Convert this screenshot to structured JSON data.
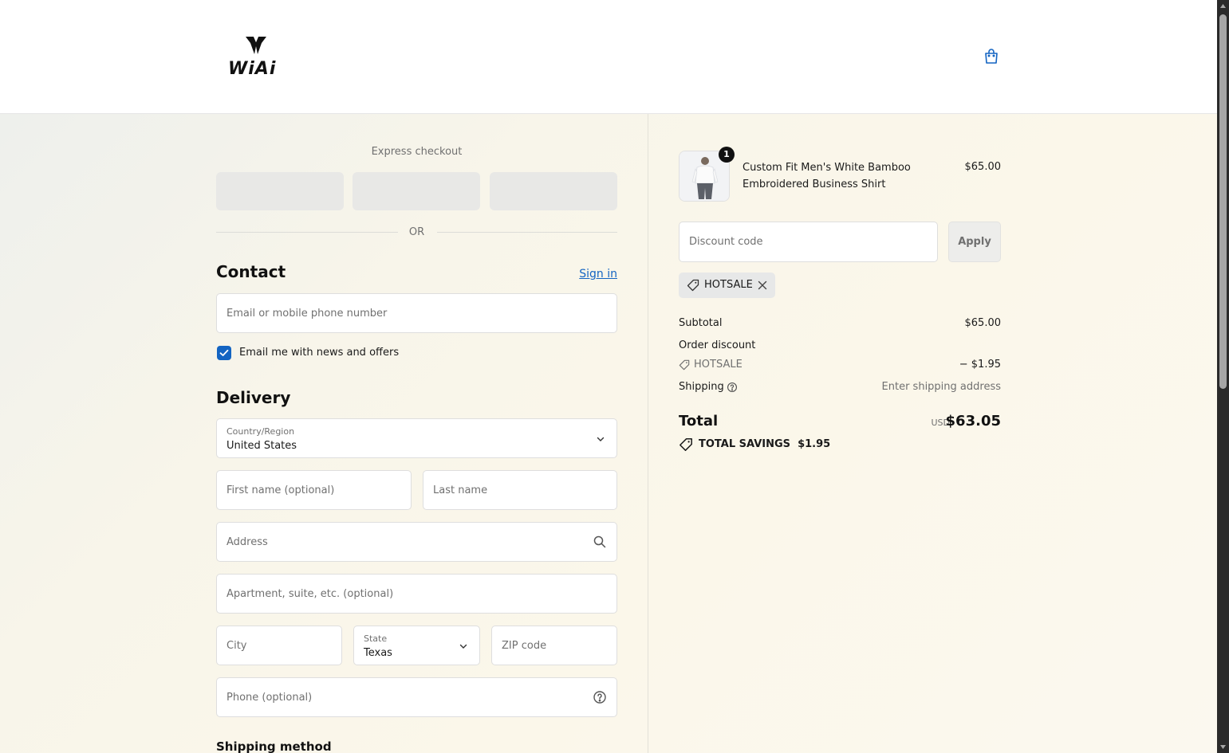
{
  "header": {
    "logo_text": "WiAi",
    "cart_icon": "shopping-bag-icon"
  },
  "express": {
    "title": "Express checkout",
    "or_label": "OR"
  },
  "contact": {
    "title": "Contact",
    "sign_in": "Sign in",
    "email_placeholder": "Email or mobile phone number",
    "newsletter_label": "Email me with news and offers",
    "newsletter_checked": true
  },
  "delivery": {
    "title": "Delivery",
    "country_label": "Country/Region",
    "country_value": "United States",
    "first_name_placeholder": "First name (optional)",
    "last_name_placeholder": "Last name",
    "address_placeholder": "Address",
    "apartment_placeholder": "Apartment, suite, etc. (optional)",
    "city_placeholder": "City",
    "state_label": "State",
    "state_value": "Texas",
    "zip_placeholder": "ZIP code",
    "phone_placeholder": "Phone (optional)"
  },
  "shipping_method": {
    "title": "Shipping method"
  },
  "summary": {
    "product": {
      "quantity": "1",
      "name": "Custom Fit Men's White Bamboo Embroidered Business Shirt",
      "price": "$65.00"
    },
    "discount_placeholder": "Discount code",
    "apply_label": "Apply",
    "applied_code": "HOTSALE",
    "subtotal_label": "Subtotal",
    "subtotal_value": "$65.00",
    "order_discount_label": "Order discount",
    "discount_code_label": "HOTSALE",
    "discount_value": "− $1.95",
    "shipping_label": "Shipping",
    "shipping_value": "Enter shipping address",
    "total_label": "Total",
    "currency": "USD",
    "total_value": "$63.05",
    "savings_label": "TOTAL SAVINGS",
    "savings_value": "$1.95"
  },
  "colors": {
    "accent": "#1364c2",
    "text": "#1a1a1a",
    "muted": "#707070"
  }
}
